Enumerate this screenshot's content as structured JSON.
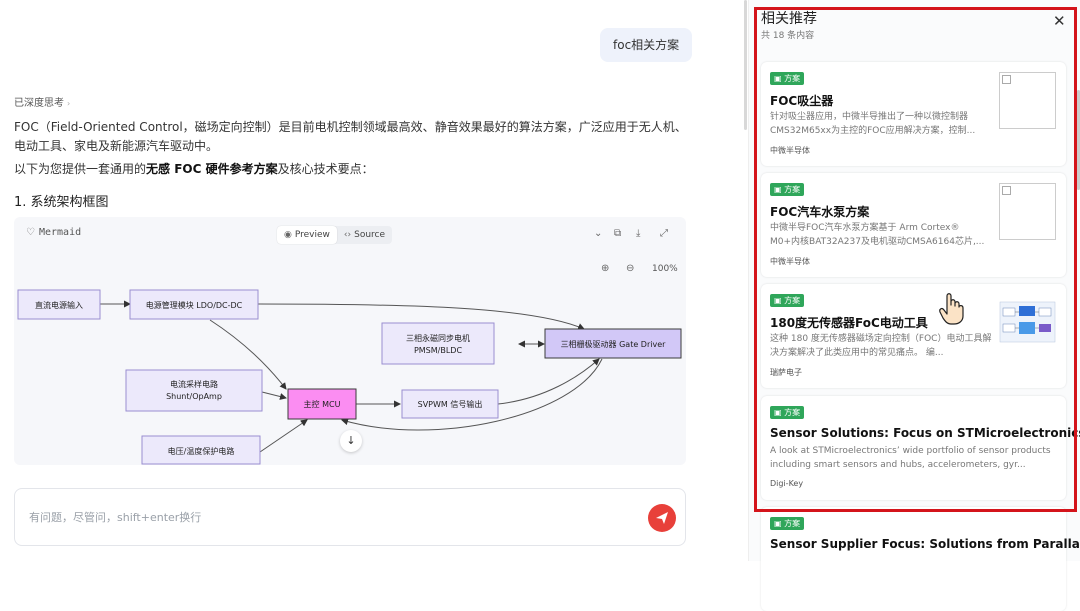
{
  "chat": {
    "user_message": "foc相关方案",
    "deep_think_label": "已深度思考",
    "para1": "FOC（Field-Oriented Control，磁场定向控制）是目前电机控制领域最高效、静音效果最好的算法方案，广泛应用于无人机、电动工具、家电及新能源汽车驱动中。",
    "para2_prefix": "以下为您提供一套通用的",
    "para2_bold": "无感 FOC 硬件参考方案",
    "para2_suffix": "及核心技术要点：",
    "section_heading": "1. 系统架构框图",
    "mermaid": {
      "label": "Mermaid",
      "tab_preview": "Preview",
      "tab_source": "Source",
      "zoom_level": "100%",
      "nodes": {
        "dc_input": "直流电源输入",
        "power_mgmt": "电源管理模块 LDO/DC-DC",
        "motor": "三相永磁同步电机",
        "motor_sub": "PMSM/BLDC",
        "gate_driver": "三相栅极驱动器 Gate Driver",
        "current_sense": "电流采样电路",
        "current_sense_sub": "Shunt/OpAmp",
        "mcu": "主控 MCU",
        "svpwm": "SVPWM 信号输出",
        "protection": "电压/温度保护电路"
      }
    },
    "input_placeholder": "有问题，尽管问，shift+enter换行"
  },
  "panel": {
    "title": "相关推荐",
    "count": "共 18 条内容",
    "cards": [
      {
        "tag": "方案",
        "title": "FOC吸尘器",
        "desc": "针对吸尘器应用，中微半导推出了一种以微控制器CMS32M65xx为主控的FOC应用解决方案，控制...",
        "source": "中微半导体",
        "thumb": "broken"
      },
      {
        "tag": "方案",
        "title": "FOC汽车水泵方案",
        "desc": "中微半导FOC汽车水泵方案基于 Arm Cortex® M0+内核BAT32A237及电机驱动CMSA6164芯片,...",
        "source": "中微半导体",
        "thumb": "broken"
      },
      {
        "tag": "方案",
        "title": "180度无传感器FoC电动工具",
        "desc": "这种 180 度无传感器磁场定向控制（FOC）电动工具解决方案解决了此类应用中的常见痛点。 编...",
        "source": "瑞萨电子",
        "thumb": "diagram"
      },
      {
        "tag": "方案",
        "title": "Sensor Solutions: Focus on STMicroelectronics",
        "desc": "A look at STMicroelectronics’ wide portfolio of sensor products including smart sensors and hubs, accelerometers, gyr...",
        "source": "Digi-Key",
        "thumb": "none"
      },
      {
        "tag": "方案",
        "title": "Sensor Supplier Focus: Solutions from Parallax",
        "desc": "",
        "source": "",
        "thumb": "none"
      }
    ]
  },
  "colors": {
    "accent_red": "#d4141b",
    "send_button": "#e8403a",
    "tag_green": "#2fa65a",
    "node_purple": "#ece9fb",
    "node_gate_driver": "#d2c8f7",
    "node_mcu": "#fb8df2"
  }
}
